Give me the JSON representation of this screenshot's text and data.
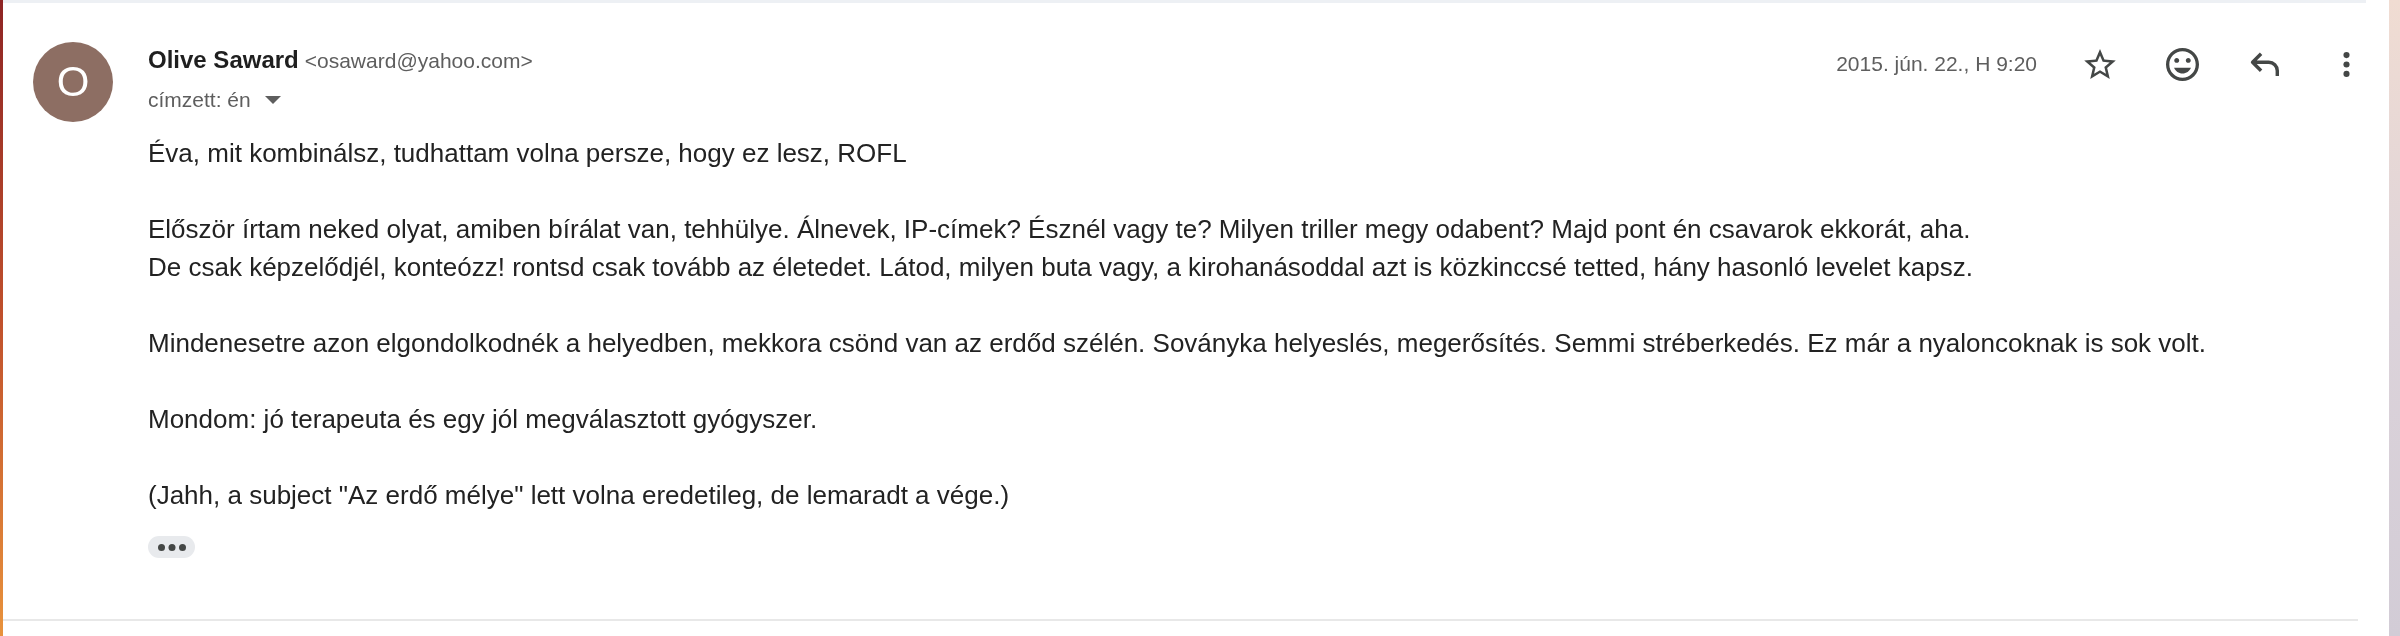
{
  "message": {
    "sender": {
      "initial": "O",
      "name": "Olive Saward",
      "email": "<osaward@yahoo.com>"
    },
    "recipients": "címzett: én",
    "date": "2015. jún. 22., H 9:20",
    "starred": false,
    "body": [
      {
        "lines": [
          "Éva, mit kombinálsz, tudhattam volna persze, hogy ez lesz, ROFL"
        ]
      },
      {
        "lines": [
          "Először írtam neked olyat, amiben bírálat van, tehhülye. Álnevek, IP-címek? Észnél vagy te? Milyen triller megy odabent? Majd pont én csavarok ekkorát, aha.",
          "De csak képzelődjél, konteózz! rontsd csak tovább az életedet. Látod, milyen buta vagy, a kirohanásoddal azt is közkinccsé tetted, hány hasonló levelet kapsz."
        ]
      },
      {
        "lines": [
          "Mindenesetre azon elgondolkodnék a helyedben, mekkora csönd van az erdőd szélén. Soványka helyeslés, megerősítés. Semmi stréberkedés. Ez már a nyaloncoknak is sok volt."
        ]
      },
      {
        "lines": [
          "Mondom: jó terapeuta és egy jól megválasztott gyógyszer."
        ]
      },
      {
        "lines": [
          "(Jahh, a subject \"Az erdő mélye\" lett volna eredetileg, de lemaradt a vége.)"
        ]
      }
    ]
  }
}
